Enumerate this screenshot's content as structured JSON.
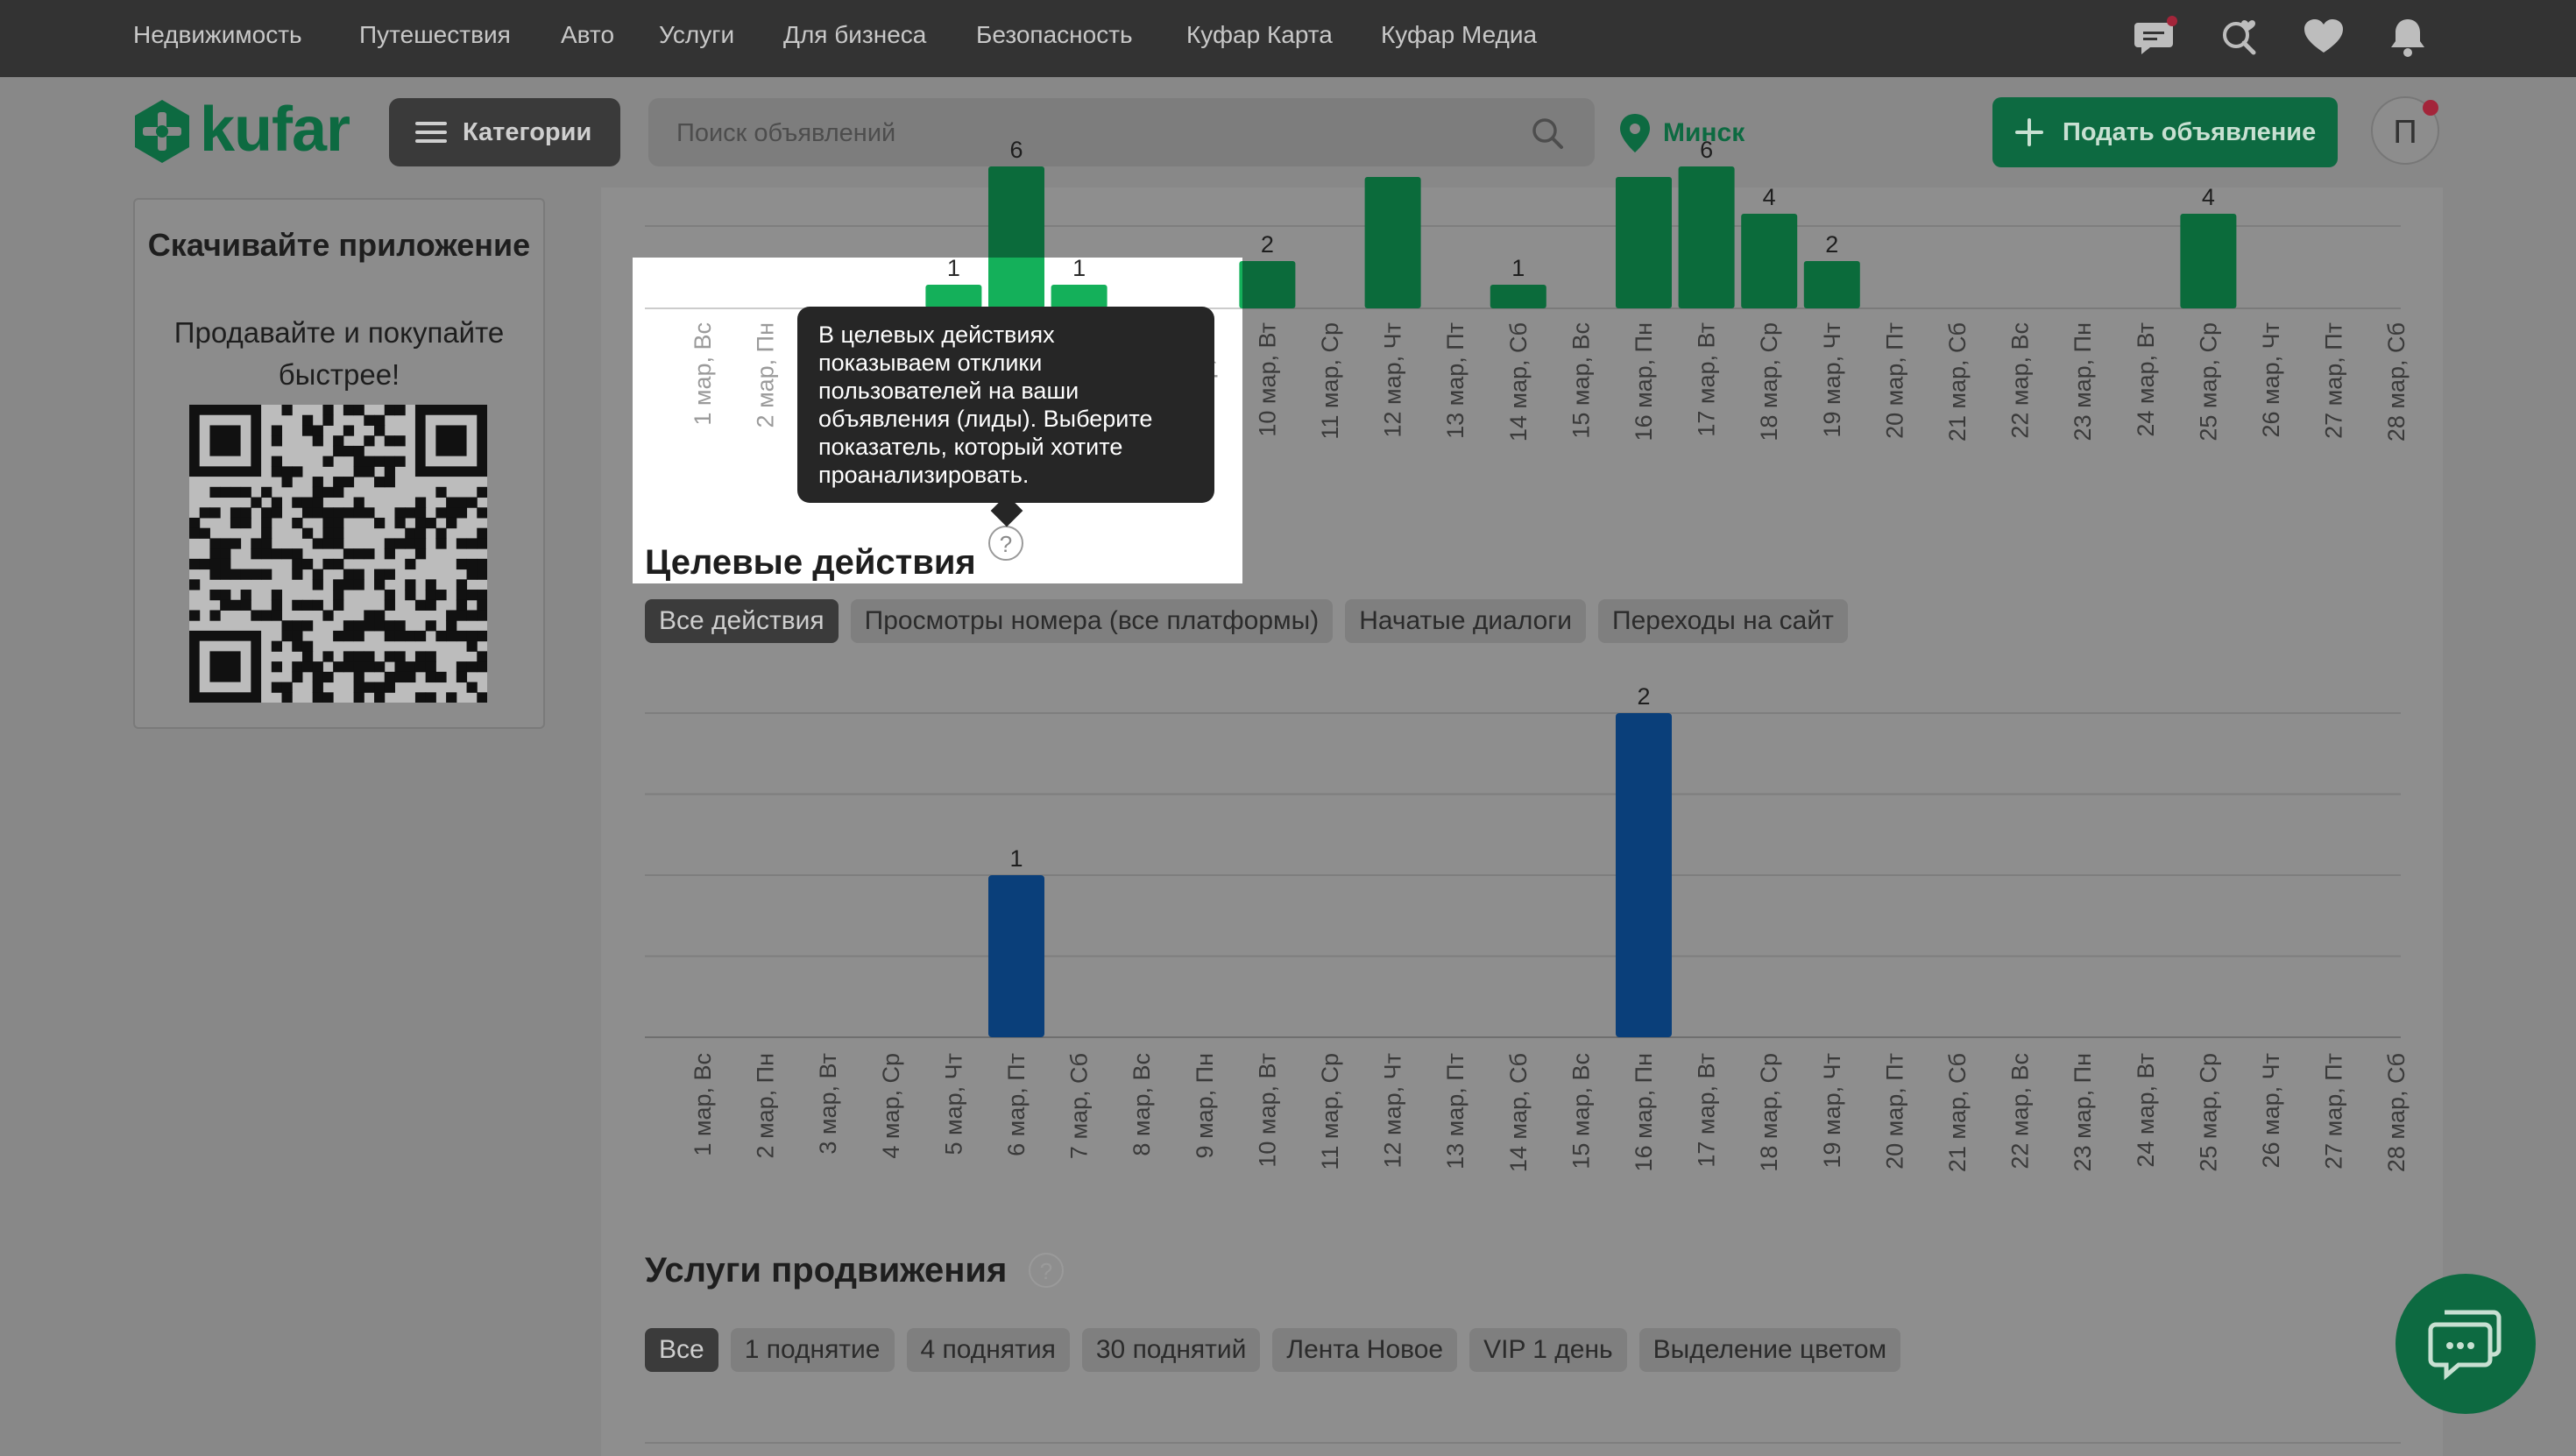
{
  "topnav": {
    "links": [
      "Недвижимость",
      "Путешествия",
      "Авто",
      "Услуги",
      "Для бизнеса",
      "Безопасность",
      "Куфар Карта",
      "Куфар Медиа"
    ],
    "icons": [
      "chat-icon",
      "search-heart-icon",
      "heart-icon",
      "bell-icon"
    ]
  },
  "header": {
    "logo_text": "kufar",
    "categories_label": "Категории",
    "search_placeholder": "Поиск объявлений",
    "location": "Минск",
    "post_label": "Подать объявление",
    "avatar_letter": "П"
  },
  "sidebar": {
    "title": "Скачивайте приложение",
    "subtitle": "Продавайте и покупайте быстрее!"
  },
  "categories_dates": [
    "1 мар, Вс",
    "2 мар, Пн",
    "3 мар, Вт",
    "4 мар, Ср",
    "5 мар, Чт",
    "6 мар, Пт",
    "7 мар, Сб",
    "8 мар, Вс",
    "9 мар, Пн",
    "10 мар, Вт",
    "11 мар, Ср",
    "12 мар, Чт",
    "13 мар, Пт",
    "14 мар, Сб",
    "15 мар, Вс",
    "16 мар, Пн",
    "17 мар, Вт",
    "18 мар, Ср",
    "19 мар, Чт",
    "20 мар, Пт",
    "21 мар, Сб",
    "22 мар, Вс",
    "23 мар, Пн",
    "24 мар, Вт",
    "25 мар, Ср",
    "26 мар, Чт",
    "27 мар, Пт",
    "28 мар, Сб"
  ],
  "chart_data": [
    {
      "type": "bar",
      "title": "",
      "series": [
        {
          "values": [
            null,
            null,
            null,
            null,
            1,
            6,
            1,
            null,
            null,
            2,
            null,
            null,
            null,
            1,
            null,
            null,
            6,
            4,
            2,
            null,
            null,
            null,
            null,
            null,
            4,
            null,
            null,
            null
          ]
        }
      ],
      "value_labels": [
        "",
        "",
        "",
        "",
        "1",
        "6",
        "1",
        "",
        "",
        "2",
        "",
        "",
        "",
        "1",
        "",
        "",
        "6",
        "4",
        "2",
        "",
        "",
        "",
        "",
        "",
        "4",
        "",
        "",
        ""
      ],
      "hidden_values_note": "",
      "color": "#0b6b3b",
      "highlight_color": "#14b05a"
    },
    {
      "type": "bar",
      "title": "Целевые действия",
      "series": [
        {
          "values": [
            0,
            0,
            0,
            0,
            0,
            1,
            0,
            0,
            0,
            0,
            0,
            0,
            0,
            0,
            0,
            2,
            0,
            0,
            0,
            0,
            0,
            0,
            0,
            0,
            0,
            0,
            0,
            0
          ]
        }
      ],
      "value_labels": [
        "",
        "",
        "",
        "",
        "",
        "1",
        "",
        "",
        "",
        "",
        "",
        "",
        "",
        "",
        "",
        "2",
        "",
        "",
        "",
        "",
        "",
        "",
        "",
        "",
        "",
        "",
        "",
        ""
      ],
      "ylim": [
        0,
        2
      ],
      "color": "#0a3f7a"
    }
  ],
  "chart1_extra_full_bars": [
    11,
    15
  ],
  "targets": {
    "title": "Целевые действия",
    "chips": [
      "Все действия",
      "Просмотры номера (все платформы)",
      "Начатые диалоги",
      "Переходы на сайт"
    ],
    "tooltip": "В целевых действиях показываем отклики пользователей на ваши объявления (лиды). Выберите показатель, который хотите проанализировать."
  },
  "promo": {
    "title": "Услуги продвижения",
    "chips": [
      "Все",
      "1 поднятие",
      "4 поднятия",
      "30 поднятий",
      "Лента Новое",
      "VIP 1 день",
      "Выделение цветом"
    ]
  },
  "help_symbol": "?",
  "colors": {
    "brand": "#0d6a41",
    "overlay": "#888888",
    "topbar": "#333333",
    "bar_blue": "#0a3f7a"
  }
}
